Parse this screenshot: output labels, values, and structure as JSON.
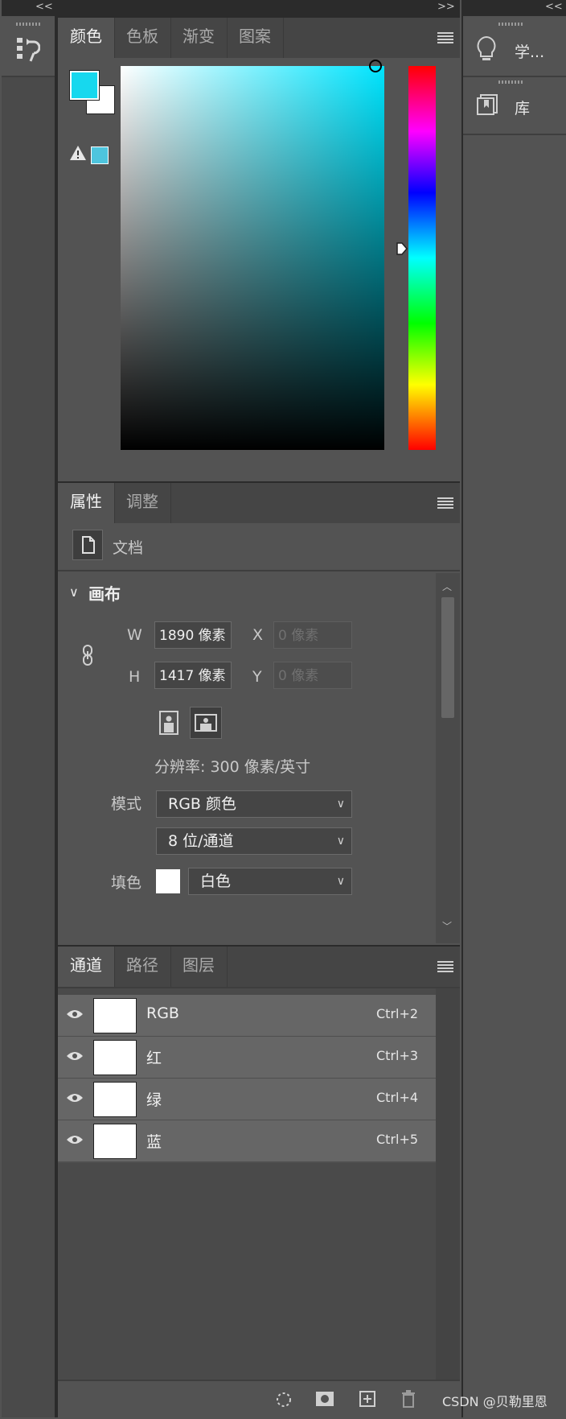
{
  "left_column": {
    "collapse_label": "<<",
    "history_icon": "history-icon"
  },
  "right_column": {
    "collapse_label": "<<",
    "items": [
      {
        "label": "学...",
        "icon": "lightbulb-icon"
      },
      {
        "label": "库",
        "icon": "library-icon"
      }
    ]
  },
  "main": {
    "expand_label": ">>"
  },
  "color_panel": {
    "tabs": [
      "颜色",
      "色板",
      "渐变",
      "图案"
    ],
    "active_tab": 0,
    "foreground_color": "#17d8ee",
    "background_color": "#ffffff",
    "gamut_warning_color": "#4ec5de",
    "hue_color": "#00e5ff"
  },
  "properties_panel": {
    "tabs": [
      "属性",
      "调整"
    ],
    "active_tab": 0,
    "doc_label": "文档",
    "section_title": "画布",
    "w_label": "W",
    "h_label": "H",
    "x_label": "X",
    "y_label": "Y",
    "w_value": "1890 像素",
    "h_value": "1417 像素",
    "x_value": "0 像素",
    "y_value": "0 像素",
    "resolution": "分辨率: 300 像素/英寸",
    "mode_label": "模式",
    "mode_value": "RGB 颜色",
    "depth_value": "8 位/通道",
    "fill_label": "填色",
    "fill_value": "白色"
  },
  "channels_panel": {
    "tabs": [
      "通道",
      "路径",
      "图层"
    ],
    "active_tab": 0,
    "rows": [
      {
        "name": "RGB",
        "shortcut": "Ctrl+2"
      },
      {
        "name": "红",
        "shortcut": "Ctrl+3"
      },
      {
        "name": "绿",
        "shortcut": "Ctrl+4"
      },
      {
        "name": "蓝",
        "shortcut": "Ctrl+5"
      }
    ]
  },
  "watermark": "CSDN @贝勒里恩"
}
